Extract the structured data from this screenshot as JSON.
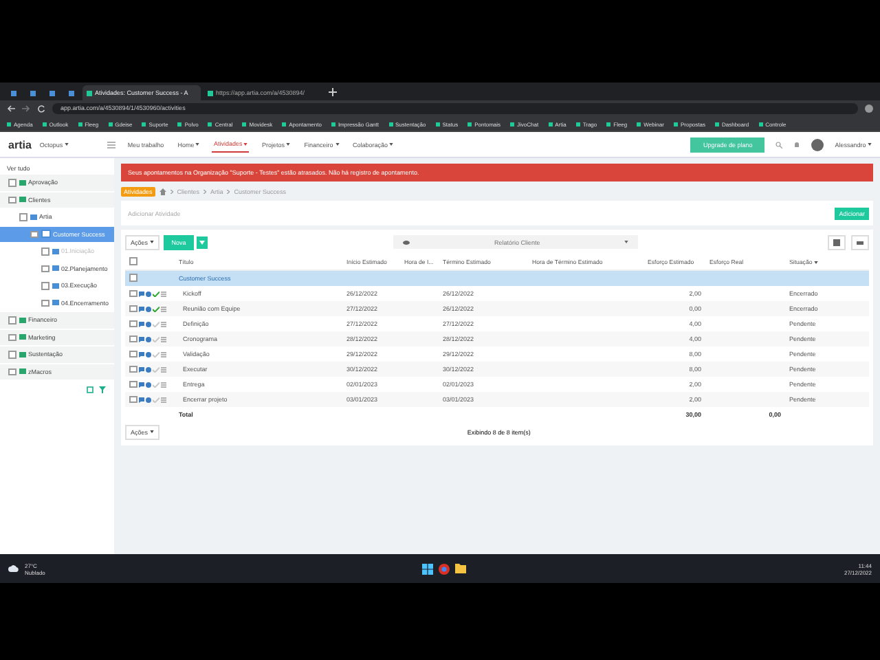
{
  "browser": {
    "tabs": [
      {
        "kind": "pinned",
        "selected": false
      },
      {
        "kind": "pinned",
        "selected": false
      },
      {
        "kind": "pinned",
        "selected": false
      },
      {
        "kind": "pinned",
        "selected": false
      },
      {
        "label": "Atividades: Customer Success - A",
        "kind": "page",
        "selected": true
      },
      {
        "label": "https://app.artia.com/a/4530894/",
        "kind": "page",
        "selected": false
      }
    ],
    "url": "app.artia.com/a/4530894/1/4530960/activities",
    "bookmarks": [
      "Agenda",
      "Outlook",
      "Fleeg",
      "Gdeise",
      "Suporte",
      "Polvo",
      "Central",
      "Movidesk",
      "Apontamento",
      "Impressão Gantt",
      "Sustentação",
      "Status",
      "Pontomais",
      "JivoChat",
      "Artia",
      "Trago",
      "Fleeg",
      "Webinar",
      "Propostas",
      "Dashboard",
      "Controle"
    ]
  },
  "app": {
    "logo": "artia",
    "organization": "Octopus",
    "nav": [
      {
        "label": "Meu trabalho",
        "menu": false,
        "selected": false
      },
      {
        "label": "Home",
        "menu": true,
        "selected": false
      },
      {
        "label": "Atividades",
        "menu": true,
        "selected": true
      },
      {
        "label": "Projetos",
        "menu": true,
        "selected": false
      },
      {
        "label": "Financeiro",
        "menu": true,
        "selected": false
      },
      {
        "label": "Colaboração",
        "menu": true,
        "selected": false
      }
    ],
    "upgrade": "Upgrade de plano",
    "user": "Alessandro"
  },
  "sidebar": {
    "view_all": "Ver tudo",
    "tree": [
      {
        "label": "Aprovação",
        "kind": "group",
        "selected": false,
        "disabled": false
      },
      {
        "label": "Clientes",
        "kind": "group",
        "selected": false,
        "disabled": false,
        "children": [
          {
            "label": "Artia",
            "kind": "folder",
            "selected": false,
            "disabled": false,
            "children": [
              {
                "label": "Customer Success",
                "kind": "page",
                "selected": true,
                "disabled": false,
                "children": [
                  {
                    "label": "01.Iniciação",
                    "kind": "folder",
                    "selected": false,
                    "disabled": true
                  },
                  {
                    "label": "02.Planejamento",
                    "kind": "folder",
                    "selected": false,
                    "disabled": false
                  },
                  {
                    "label": "03.Execução",
                    "kind": "folder",
                    "selected": false,
                    "disabled": false
                  },
                  {
                    "label": "04.Encerramento",
                    "kind": "folder",
                    "selected": false,
                    "disabled": false
                  }
                ]
              }
            ]
          }
        ]
      },
      {
        "label": "Financeiro",
        "kind": "group",
        "selected": false,
        "disabled": false
      },
      {
        "label": "Marketing",
        "kind": "group",
        "selected": false,
        "disabled": false
      },
      {
        "label": "Sustentação",
        "kind": "group",
        "selected": false,
        "disabled": false
      },
      {
        "label": "zMacros",
        "kind": "group",
        "selected": false,
        "disabled": false
      }
    ]
  },
  "alert": "Seus apontamentos na Organização \"Suporte - Testes\" estão atrasados. Não há registro de apontamento.",
  "breadcrumb": {
    "badge": "Atividades",
    "path": [
      "Clientes",
      "Artia",
      "Customer Success"
    ]
  },
  "add_activity": {
    "placeholder": "Adicionar Atividade",
    "button": "Adicionar"
  },
  "toolbar": {
    "actions": "Ações",
    "new": "Nova",
    "report": "Relatório Cliente"
  },
  "table": {
    "columns": [
      "Título",
      "Início Estimado",
      "Hora de I...",
      "Término Estimado",
      "Hora de Término Estimado",
      "Esforço Estimado",
      "Esforço Real",
      "Situação"
    ],
    "all_checked": false,
    "group": "Customer Success",
    "group_checked": false,
    "rows": [
      {
        "title": "Kickoff",
        "start": "26/12/2022",
        "end": "26/12/2022",
        "effort": "2,00",
        "status": "Encerrado",
        "done": true,
        "checked": false
      },
      {
        "title": "Reunião com Equipe",
        "start": "27/12/2022",
        "end": "26/12/2022",
        "effort": "0,00",
        "status": "Encerrado",
        "done": true,
        "checked": false
      },
      {
        "title": "Definição",
        "start": "27/12/2022",
        "end": "27/12/2022",
        "effort": "4,00",
        "status": "Pendente",
        "done": false,
        "checked": false
      },
      {
        "title": "Cronograma",
        "start": "28/12/2022",
        "end": "28/12/2022",
        "effort": "4,00",
        "status": "Pendente",
        "done": false,
        "checked": false
      },
      {
        "title": "Validação",
        "start": "29/12/2022",
        "end": "29/12/2022",
        "effort": "8,00",
        "status": "Pendente",
        "done": false,
        "checked": false
      },
      {
        "title": "Executar",
        "start": "30/12/2022",
        "end": "30/12/2022",
        "effort": "8,00",
        "status": "Pendente",
        "done": false,
        "checked": false
      },
      {
        "title": "Entrega",
        "start": "02/01/2023",
        "end": "02/01/2023",
        "effort": "2,00",
        "status": "Pendente",
        "done": false,
        "checked": false
      },
      {
        "title": "Encerrar projeto",
        "start": "03/01/2023",
        "end": "03/01/2023",
        "effort": "2,00",
        "status": "Pendente",
        "done": false,
        "checked": false
      }
    ],
    "total": {
      "label": "Total",
      "effort": "30,00",
      "real": "0,00"
    },
    "footer": "Exibindo 8 de 8 item(s)",
    "footer_actions": "Ações"
  },
  "taskbar": {
    "temperature": "27°C",
    "weather": "Nublado",
    "time": "11:44",
    "date": "27/12/2022"
  }
}
